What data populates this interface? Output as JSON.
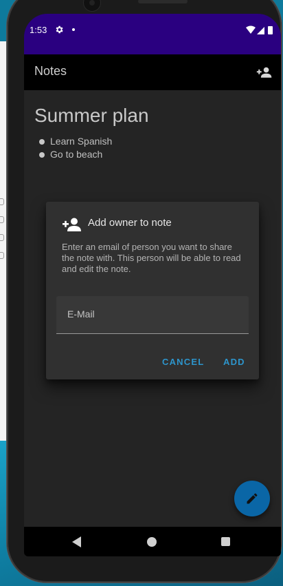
{
  "status_bar": {
    "time": "1:53"
  },
  "app_bar": {
    "title": "Notes"
  },
  "note": {
    "title": "Summer plan",
    "items": [
      "Learn Spanish",
      "Go to beach"
    ]
  },
  "dialog": {
    "title": "Add owner to note",
    "message": "Enter an email of person you want to share the note with. This person will be able to read and edit the note.",
    "email_placeholder": "E-Mail",
    "cancel_label": "CANCEL",
    "add_label": "ADD"
  },
  "colors": {
    "status_bar": "#2a0080",
    "accent": "#2d95cc",
    "fab": "#0a66a6",
    "background": "#242424"
  },
  "icons": {
    "app_bar_action": "person-add-icon",
    "dialog": "person-add-icon",
    "fab": "pencil-icon",
    "status": [
      "gear-icon",
      "wifi-icon",
      "signal-icon",
      "battery-icon"
    ],
    "nav": [
      "back-icon",
      "home-icon",
      "recent-apps-icon"
    ]
  }
}
